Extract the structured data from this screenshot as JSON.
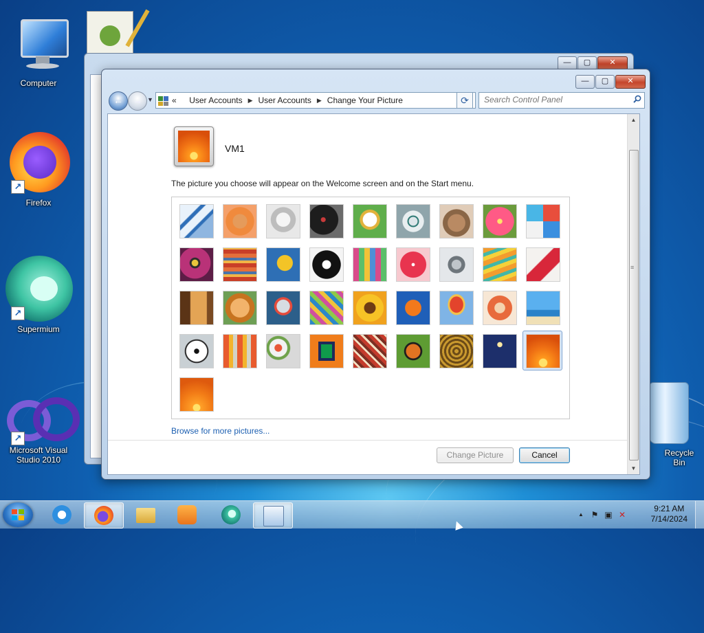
{
  "desktop": {
    "icons": [
      {
        "label": "Computer"
      },
      {
        "label": "Firefox"
      },
      {
        "label": "Supermium"
      },
      {
        "label": "Microsoft Visual Studio 2010"
      },
      {
        "label": "Recycle Bin"
      }
    ]
  },
  "window": {
    "breadcrumb": {
      "prefix": "«",
      "items": [
        "User Accounts",
        "User Accounts",
        "Change Your Picture"
      ]
    },
    "search": {
      "placeholder": "Search Control Panel"
    },
    "user": {
      "name": "VM1"
    },
    "description": "The picture you choose will appear on the Welcome screen and on the Start menu.",
    "pictures": [
      "roller-coaster",
      "starfish",
      "robot-dog",
      "turntable",
      "lucky-cat",
      "gyroscope",
      "kitten",
      "pink-flower",
      "pinwheel",
      "ball",
      "fabric",
      "leaf",
      "dog",
      "crayons",
      "star-ornament",
      "jacks",
      "stairs",
      "paper-crane",
      "guitar",
      "puppy",
      "toy-robot",
      "scarf",
      "sunflower",
      "fish",
      "hot-air-balloon",
      "doll",
      "sailboat",
      "soccer-ball",
      "striped-fabric",
      "marbles",
      "window",
      "pattern",
      "butterfly",
      "weave",
      "lighthouse",
      "orange-flower",
      "orange-flower-alt"
    ],
    "selected_picture": "orange-flower",
    "browse_link": "Browse for more pictures...",
    "buttons": {
      "change": "Change Picture",
      "cancel": "Cancel"
    }
  },
  "taskbar": {
    "clock": {
      "time": "9:21 AM",
      "date": "7/14/2024"
    },
    "tray_chevron": "▲"
  },
  "colors": {
    "link": "#1c5fb1",
    "selection": "#dce9f8",
    "close_button": "#c5452b"
  }
}
